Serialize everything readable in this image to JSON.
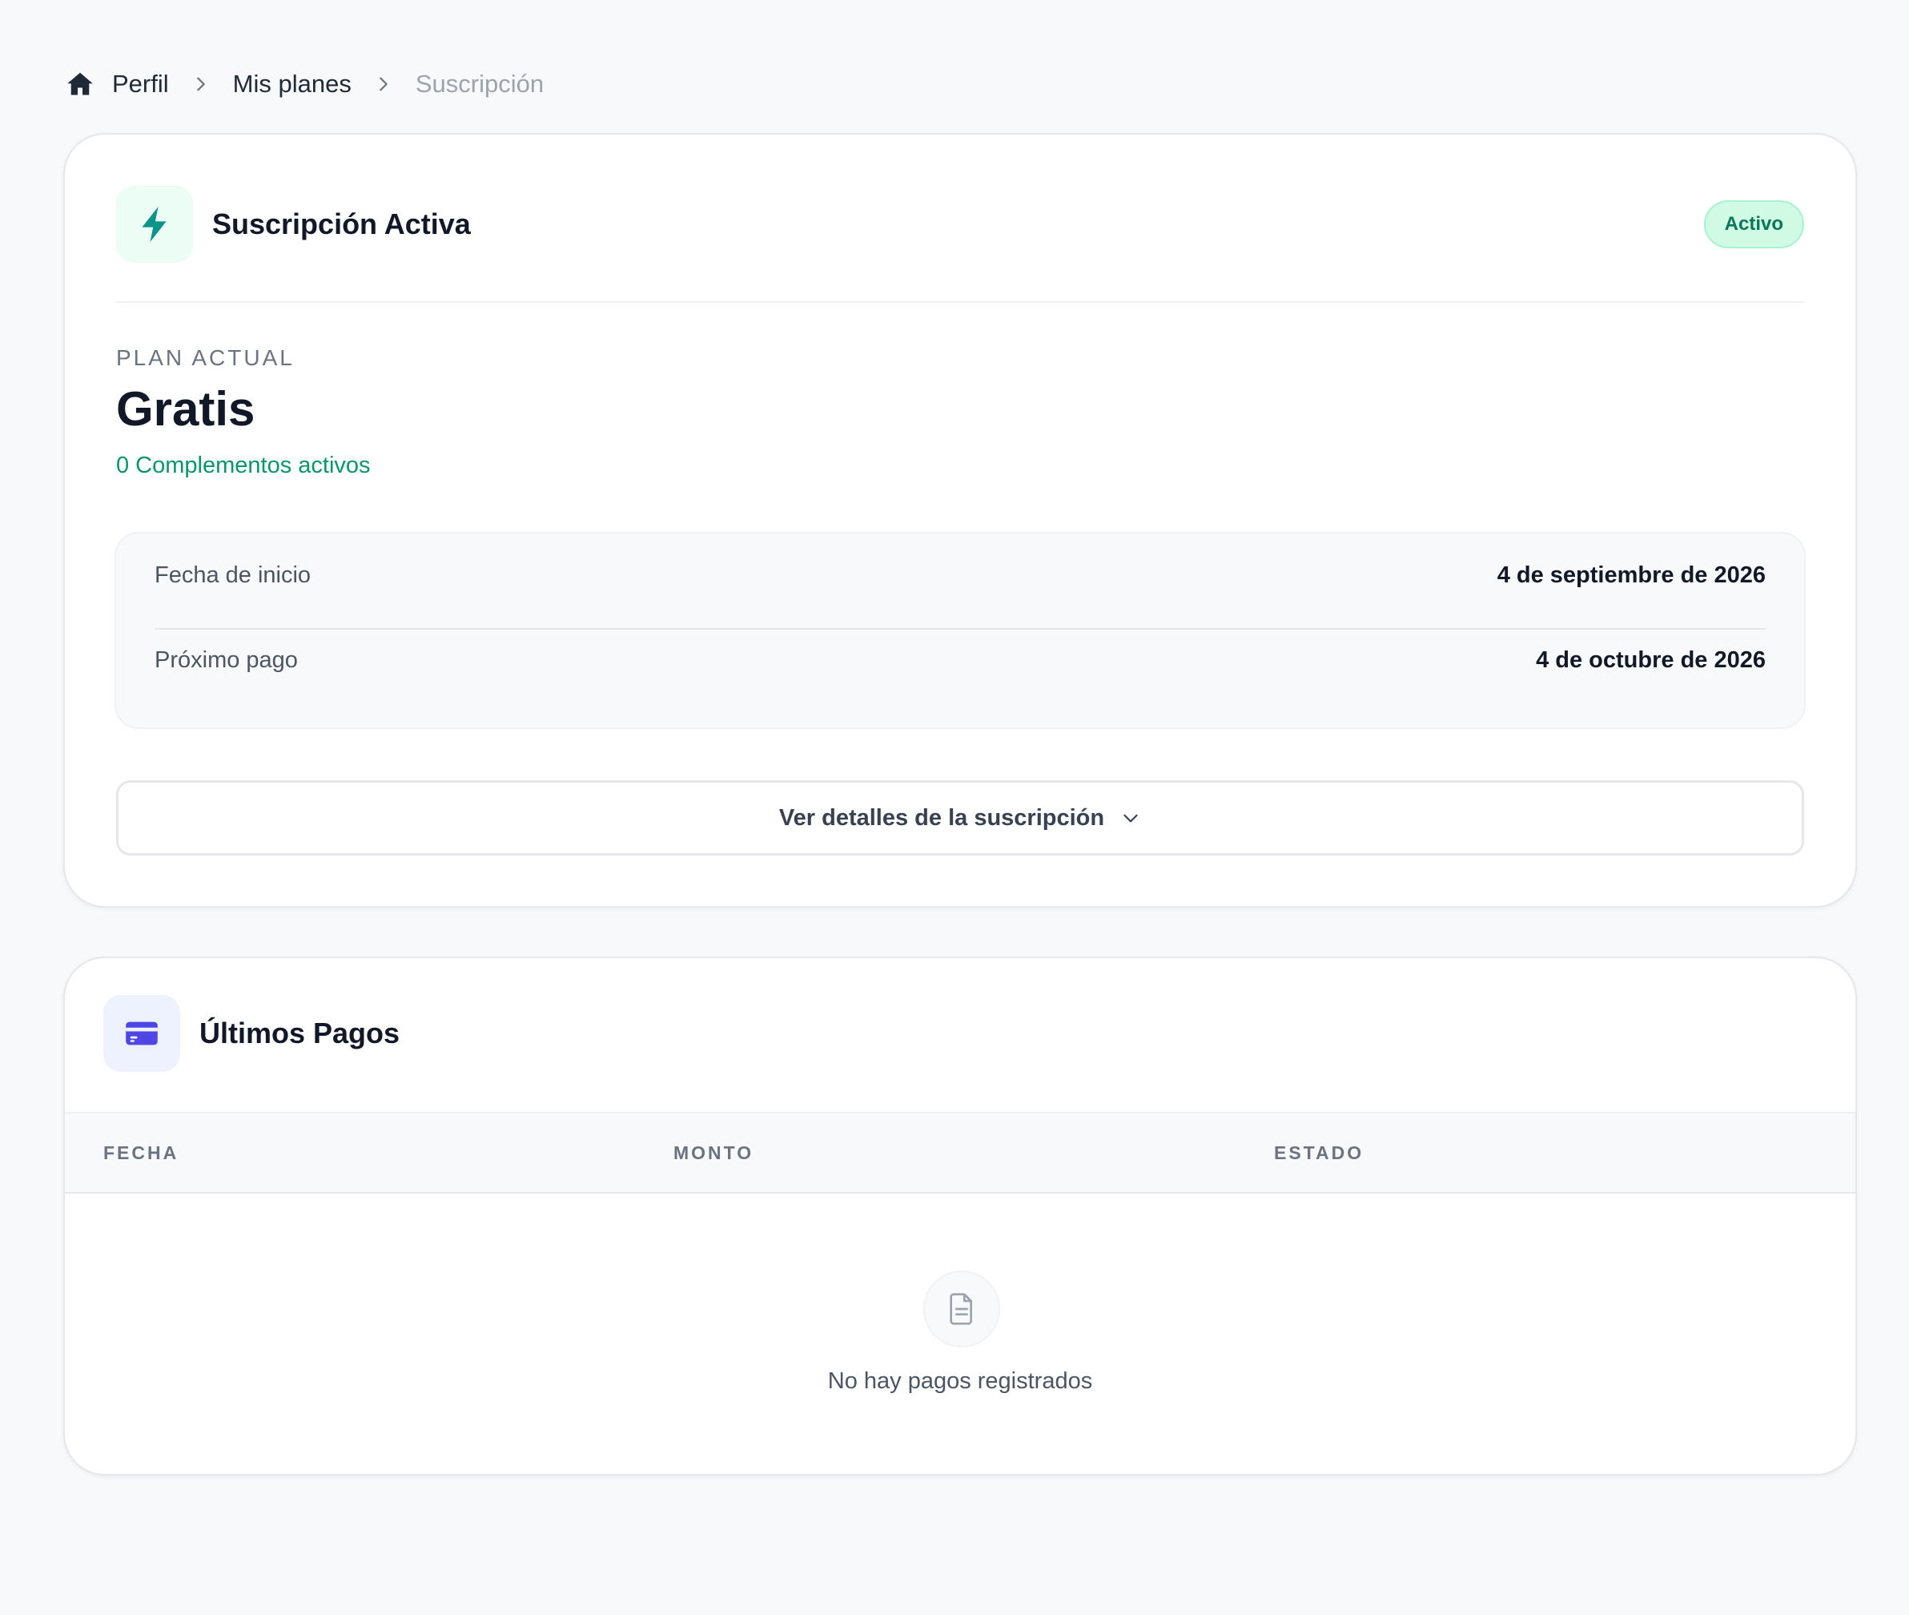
{
  "breadcrumb": {
    "home_icon": "home-icon",
    "items": [
      "Perfil",
      "Mis planes"
    ],
    "current": "Suscripción"
  },
  "subscription": {
    "icon": "lightning-bolt-icon",
    "title": "Suscripción Activa",
    "status_badge": "Activo",
    "plan_label": "PLAN ACTUAL",
    "plan_name": "Gratis",
    "addons_text": "0 Complementos activos",
    "dates": [
      {
        "label": "Fecha de inicio",
        "value": "4 de septiembre de 2026"
      },
      {
        "label": "Próximo pago",
        "value": "4 de octubre de 2026"
      }
    ],
    "details_button": "Ver detalles de la suscripción"
  },
  "payments": {
    "icon": "credit-card-icon",
    "title": "Últimos Pagos",
    "columns": [
      "FECHA",
      "MONTO",
      "ESTADO"
    ],
    "rows": [],
    "empty_icon": "document-icon",
    "empty_text": "No hay pagos registrados"
  },
  "colors": {
    "accent_green": "#059669",
    "badge_bg": "#d1fae5",
    "badge_text": "#047857",
    "card_icon_indigo": "#4f46e5"
  }
}
